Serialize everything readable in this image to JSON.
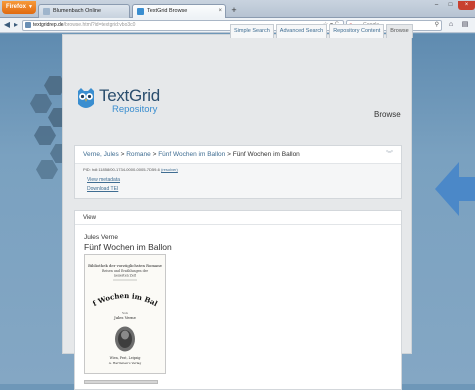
{
  "browser": {
    "firefox_label": "Firefox",
    "tabs": [
      {
        "title": "Blumenbach Online",
        "active": false
      },
      {
        "title": "TextGrid Browse",
        "active": true
      }
    ],
    "url_host": "textgridrep.de",
    "url_path": "/browse.html?id=textgrid:vbo3c0",
    "search_placeholder": "Google"
  },
  "nav": {
    "tabs": [
      "Simple Search",
      "Advanced Search",
      "Repository Content",
      "Browse"
    ],
    "selected": "Browse"
  },
  "logo": {
    "title": "TextGrid",
    "subtitle": "Repository"
  },
  "page_label": "Browse",
  "breadcrumb": {
    "author": "Verne, Jules",
    "sep1": ">",
    "genre": "Romane",
    "sep2": ">",
    "edition": "Fünf Wochen im Ballon",
    "sep3": ">",
    "current": "Fünf Wochen im Ballon"
  },
  "details": {
    "pid": "PID: hdl:11858/00-1734-0000-0005-7D59-6",
    "resolver": "(resolver)",
    "view_metadata": "View metadata",
    "download_tei": "Download TEI"
  },
  "view": {
    "header": "View",
    "author": "Jules Verne",
    "title": "Fünf Wochen im Ballon"
  },
  "scan": {
    "top_lines": [
      "Bibliothek der vorzüglichsten Romane",
      "Reisen und Erzählungen der",
      "neuesten Zeit"
    ],
    "title_lines": [
      "Fünf Wochen im Ballon."
    ],
    "author_lines": [
      "Von",
      "Jules Verne"
    ],
    "bottom_lines": [
      "Wien, Pest, Leipzig",
      "A. Hartleben's Verlag"
    ]
  },
  "colors": {
    "accent": "#3f6d92",
    "logo_blue": "#3a8ed0",
    "arrow": "#4b88c8"
  }
}
